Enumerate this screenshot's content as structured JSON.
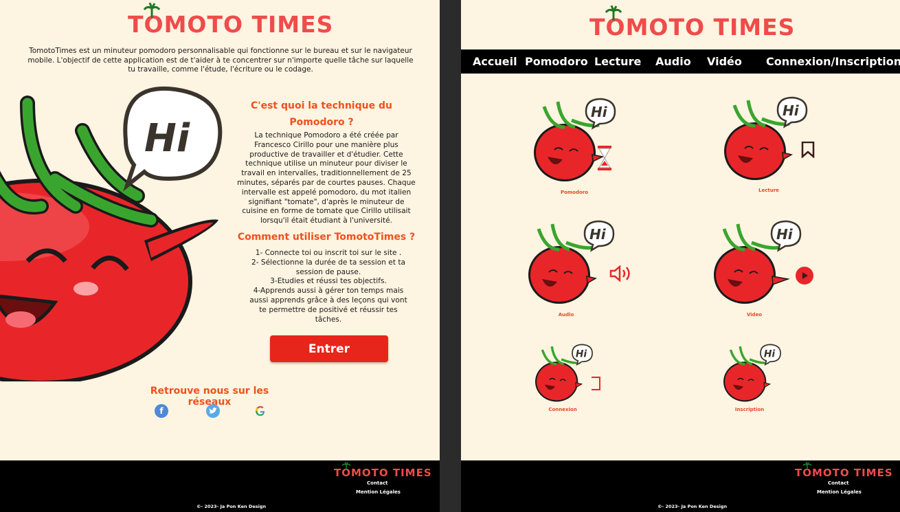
{
  "brand": {
    "logo_text": "TOMOTO TIMES"
  },
  "colors": {
    "accent": "#f04b4b",
    "heading": "#f0501e",
    "button": "#e8251a",
    "background": "#fdf4e1",
    "tomato": "#e8262a",
    "leaf": "#3aa52e"
  },
  "left_page": {
    "intro": "TomotoTimes est un minuteur pomodoro personnalisable qui fonctionne sur le bureau et sur le navigateur mobile. L'objectif de cette application est de  t'aider à te concentrer sur n'importe quelle tâche sur laquelle tu travaille, comme l'étude, l'écriture ou le codage.",
    "mascot_bubble": "Hi",
    "technique_heading_line1": "C'est quoi la technique du",
    "technique_heading_line2": "Pomodoro ?",
    "technique_text": "La technique Pomodoro a été créée par Francesco Cirillo pour une manière plus productive de travailler et d'étudier. Cette technique utilise un minuteur pour diviser le travail en intervalles, traditionnellement de 25 minutes, séparés par de courtes pauses. Chaque intervalle est appelé pomodoro, du mot italien signifiant \"tomate\", d'après le minuteur de cuisine en forme de tomate que Cirillo utilisait lorsqu'il était étudiant à l'université.",
    "usage_heading": "Comment utiliser TomotoTimes ?",
    "usage_steps": [
      "1- Connecte toi ou inscrit toi sur le site .",
      "2- Sélectionne la durée de ta session et ta session de pause.",
      "3-Etudies et réussi tes objectifs.",
      "4-Apprends aussi à gérer ton temps mais aussi apprends grâce à des leçons qui vont te permettre de positivé et réussir tes tâches."
    ],
    "enter_button": "Entrer",
    "social_heading": "Retrouve nous sur les réseaux",
    "social_icons": [
      "facebook-icon",
      "twitter-icon",
      "google-icon"
    ]
  },
  "right_page": {
    "nav": [
      "Accueil",
      "Pomodoro",
      "Lecture",
      "Audio",
      "Vidéo",
      "Connexion/Inscription"
    ],
    "cards": [
      {
        "label": "Pomodoro",
        "icon": "hourglass-icon"
      },
      {
        "label": "Lecture",
        "icon": "bookmark-icon"
      },
      {
        "label": "Audio",
        "icon": "speaker-icon"
      },
      {
        "label": "Video",
        "icon": "play-icon"
      },
      {
        "label": "Connexion",
        "icon": "login-icon"
      },
      {
        "label": "Inscription",
        "icon": "none"
      }
    ],
    "bubble": "Hi"
  },
  "footer": {
    "contact": "Contact",
    "legal": "Mention Légales",
    "copyright": "©- 2023- Ja Pon Ken Design"
  }
}
